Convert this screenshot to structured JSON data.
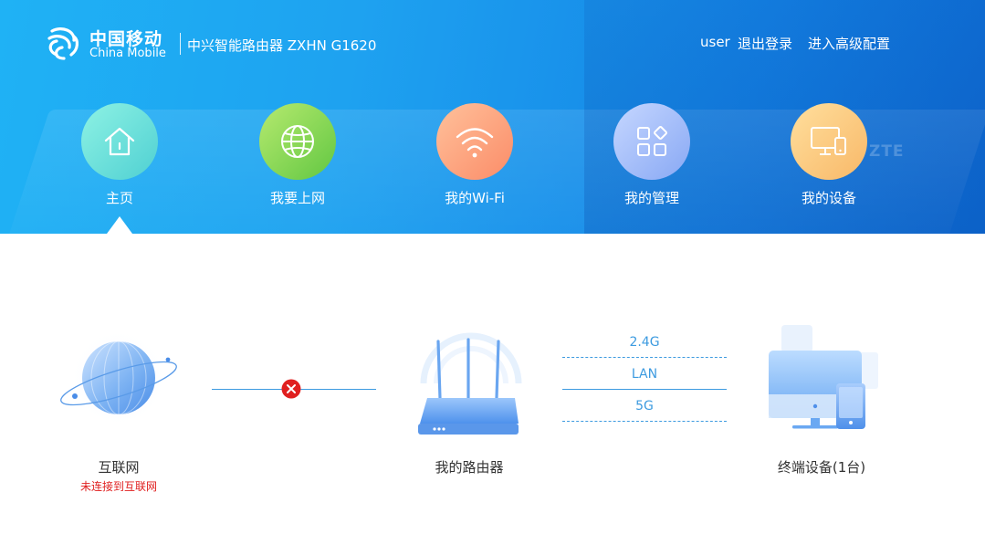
{
  "header": {
    "brand_cn": "中国移动",
    "brand_en": "China Mobile",
    "product": "中兴智能路由器 ZXHN G1620",
    "watermark": "ZTE",
    "user": "user",
    "logout": "退出登录",
    "advanced": "进入高级配置"
  },
  "nav": {
    "active": "home",
    "items": [
      {
        "id": "home",
        "label": "主页",
        "icon": "house-icon"
      },
      {
        "id": "internet",
        "label": "我要上网",
        "icon": "globe-icon"
      },
      {
        "id": "wifi",
        "label": "我的Wi-Fi",
        "icon": "wifi-icon"
      },
      {
        "id": "manage",
        "label": "我的管理",
        "icon": "grid-icon"
      },
      {
        "id": "devices",
        "label": "我的设备",
        "icon": "monitor-phone-icon"
      }
    ]
  },
  "topology": {
    "internet": {
      "label": "互联网",
      "status": "未连接到互联网",
      "status_color": "#e02020",
      "icon": "globe-icon"
    },
    "wan_link": {
      "state": "disconnected",
      "icon": "error-x-icon"
    },
    "router": {
      "label": "我的路由器",
      "icon": "router-icon"
    },
    "links": {
      "band_24g": "2.4G",
      "lan": "LAN",
      "band_5g": "5G"
    },
    "terminals": {
      "label": "终端设备(1台)",
      "icon": "monitor-phone-icon"
    }
  },
  "colors": {
    "accent": "#3d9be0",
    "error": "#e02020",
    "banner_start": "#1fb2f5",
    "banner_end": "#0f6fd6"
  }
}
